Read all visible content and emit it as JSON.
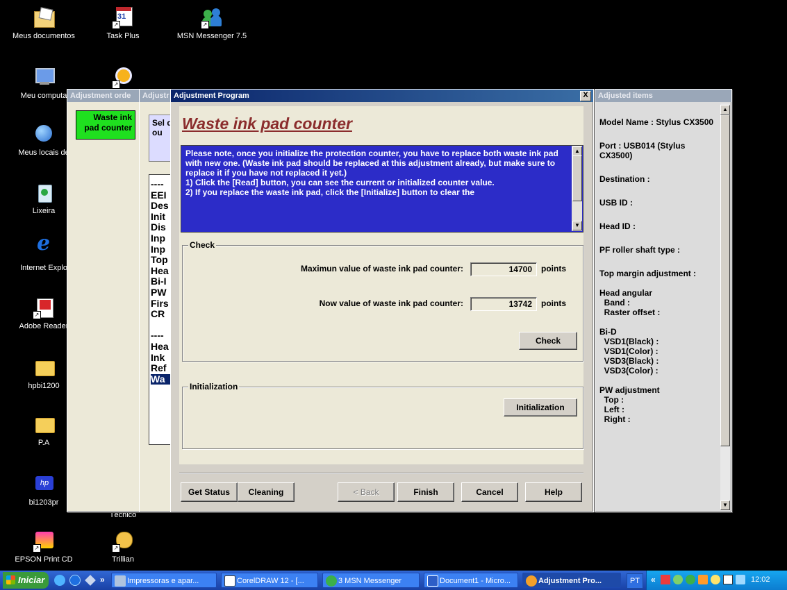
{
  "desktop": {
    "icons": [
      {
        "label": "Meus documentos"
      },
      {
        "label": "Task Plus"
      },
      {
        "label": "MSN Messenger 7.5"
      },
      {
        "label": "Meu computa"
      },
      {
        "label": "Meus locais de"
      },
      {
        "label": "Lixeira"
      },
      {
        "label": "Internet Explo"
      },
      {
        "label": "Adobe Reader"
      },
      {
        "label": "hpbi1200"
      },
      {
        "label": "P.A"
      },
      {
        "label": "bi1203pr"
      },
      {
        "label": "Técnico"
      },
      {
        "label": "EPSON Print CD"
      },
      {
        "label": "Trillian"
      }
    ]
  },
  "order_window": {
    "title": "Adjustment orde",
    "item": "Waste ink pad counter"
  },
  "list_window": {
    "title": "Adjustr",
    "select_text": "Sel dou",
    "items": [
      "----",
      "EEI",
      "Des",
      "Init",
      "Dis",
      "Inp",
      "Inp",
      "Top",
      "Hea",
      "Bi-I",
      "PW",
      "Firs",
      "CR",
      "",
      "----",
      "Hea",
      "Ink",
      "Ref",
      "Wa"
    ]
  },
  "main_window": {
    "title": "Adjustment Program",
    "close": "X",
    "heading": "Waste ink pad counter",
    "description": "Please note, once you initialize the protection counter, you have to replace both waste ink pad with new one. (Waste ink pad should be replaced at this adjustment already, but make sure to replace it if you have not replaced it yet.)\n1) Click the [Read] button, you can see the current or initialized counter value.\n2) If you replace the waste ink pad, click the [Initialize] button to clear the",
    "check_group": {
      "title": "Check",
      "max_label": "Maximun value of waste ink pad counter:",
      "max_value": "14700",
      "now_label": "Now value of waste ink pad counter:",
      "now_value": "13742",
      "unit": "points",
      "check_button": "Check"
    },
    "init_group": {
      "title": "Initialization",
      "init_button": "Initialization"
    },
    "buttons": {
      "get_status": "Get Status",
      "cleaning": "Cleaning",
      "back": "< Back",
      "finish": "Finish",
      "cancel": "Cancel",
      "help": "Help"
    }
  },
  "adjusted_window": {
    "title": "Adjusted items",
    "lines": [
      "Model Name : Stylus CX3500",
      "Port : USB014 (Stylus CX3500)",
      "Destination :",
      "USB ID :",
      "Head ID :",
      "PF roller shaft type :",
      "Top margin adjustment :",
      "Head angular\n  Band :\n  Raster offset :",
      "Bi-D\n  VSD1(Black) :\n  VSD1(Color) :\n  VSD3(Black) :\n  VSD3(Color) :",
      "PW adjustment\n  Top :\n  Left :\n  Right :"
    ]
  },
  "taskbar": {
    "start": "Iniciar",
    "chevron": "»",
    "items": [
      {
        "label": "Impressoras e apar..."
      },
      {
        "label": "CorelDRAW 12 - [..."
      },
      {
        "label": "3 MSN Messenger"
      },
      {
        "label": "Document1 - Micro..."
      },
      {
        "label": "Adjustment Pro..."
      }
    ],
    "lang": "PT",
    "tray_chevron": "«",
    "clock": "12:02"
  },
  "colors": {
    "heading": "#8b2d2d",
    "desc_bg": "#2c2cc8",
    "order_item_bg": "#1fe01f",
    "panel_bg": "#ece9d8",
    "adjusted_bg": "#dcdcdc"
  }
}
